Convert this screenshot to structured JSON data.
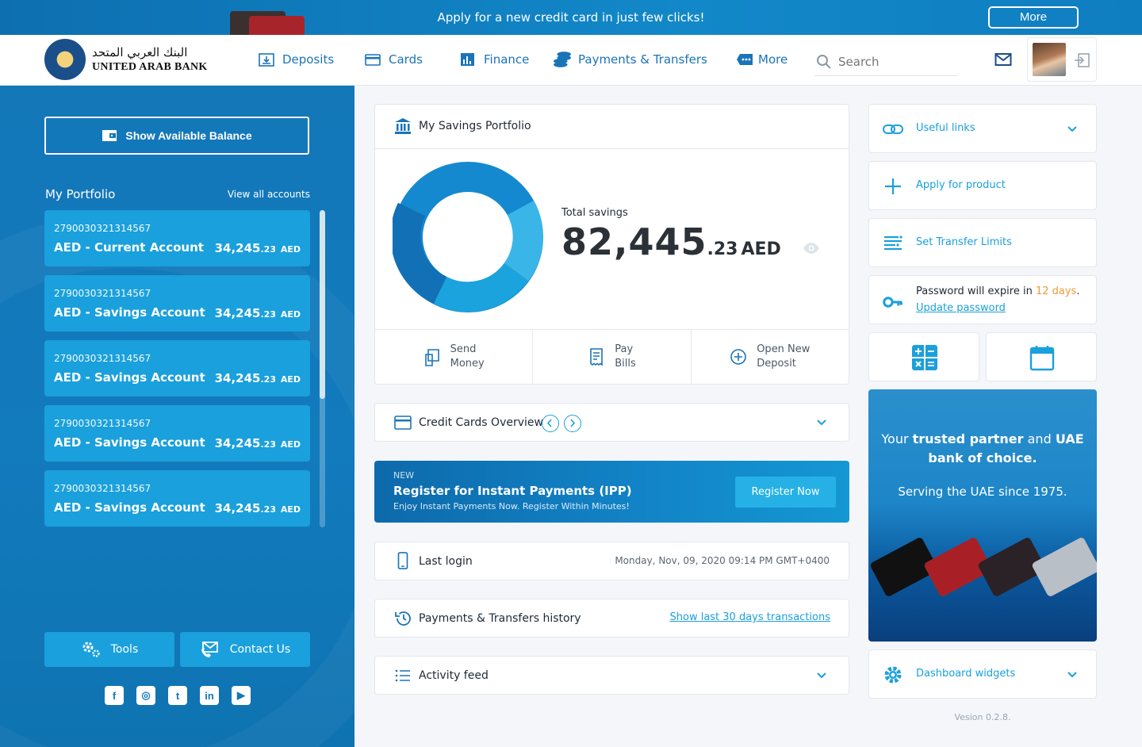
{
  "banner": {
    "text": "Apply for a new credit card in just few clicks!",
    "button": "More"
  },
  "logo": {
    "arabic": "البنك العربي المتحد",
    "english": "UNITED ARAB BANK"
  },
  "nav": [
    {
      "label": "Deposits",
      "icon": "deposits-icon"
    },
    {
      "label": "Cards",
      "icon": "cards-icon"
    },
    {
      "label": "Finance",
      "icon": "finance-icon"
    },
    {
      "label": "Payments & Transfers",
      "icon": "coins-icon"
    },
    {
      "label": "More",
      "icon": "more-icon"
    }
  ],
  "search": {
    "placeholder": "Search"
  },
  "sidebar": {
    "balance_button": "Show Available Balance",
    "portfolio_title": "My Portfolio",
    "view_all": "View all accounts",
    "accounts": [
      {
        "number": "2790030321314567",
        "name": "AED - Current Account",
        "int": "34,245",
        "dec": ".23",
        "cur": "AED"
      },
      {
        "number": "2790030321314567",
        "name": "AED - Savings Account",
        "int": "34,245",
        "dec": ".23",
        "cur": "AED"
      },
      {
        "number": "2790030321314567",
        "name": "AED - Savings Account",
        "int": "34,245",
        "dec": ".23",
        "cur": "AED"
      },
      {
        "number": "2790030321314567",
        "name": "AED - Savings Account",
        "int": "34,245",
        "dec": ".23",
        "cur": "AED"
      },
      {
        "number": "2790030321314567",
        "name": "AED - Savings Account",
        "int": "34,245",
        "dec": ".23",
        "cur": "AED"
      }
    ],
    "tools": "Tools",
    "contact": "Contact Us",
    "socials": [
      {
        "name": "facebook-icon",
        "glyph": "f"
      },
      {
        "name": "instagram-icon",
        "glyph": "◎"
      },
      {
        "name": "twitter-icon",
        "glyph": "t"
      },
      {
        "name": "linkedin-icon",
        "glyph": "in"
      },
      {
        "name": "youtube-icon",
        "glyph": "▶"
      }
    ]
  },
  "savings": {
    "title": "My Savings Portfolio",
    "total_label": "Total savings",
    "total_int": "82,445",
    "total_dec": ".23",
    "total_cur": "AED",
    "actions": [
      {
        "line1": "Send",
        "line2": "Money"
      },
      {
        "line1": "Pay",
        "line2": "Bills"
      },
      {
        "line1": "Open New",
        "line2": "Deposit"
      }
    ]
  },
  "credit_cards": {
    "title": "Credit Cards Overview"
  },
  "promo": {
    "tag": "NEW",
    "title": "Register for Instant Payments (IPP)",
    "subtitle": "Enjoy Instant Payments Now. Register Within Minutes!",
    "button": "Register Now"
  },
  "last_login": {
    "label": "Last login",
    "date": "Monday, Nov, 09, 2020 09:14 PM GMT+0400"
  },
  "history": {
    "label": "Payments & Transfers history",
    "link": "Show last 30 days transactions"
  },
  "activity": {
    "label": "Activity feed"
  },
  "right": {
    "useful_links": "Useful links",
    "apply_product": "Apply for product",
    "transfer_limits": "Set Transfer Limits",
    "pw_prefix": "Password will expire in ",
    "pw_days": "12 days",
    "pw_suffix": ".",
    "pw_link": "Update password",
    "ad_line1a": "Your ",
    "ad_line1b": "trusted partner",
    "ad_line1c": " and ",
    "ad_line1d": "UAE bank of choice.",
    "ad_line2": "Serving the UAE since 1975.",
    "dashboard_widgets": "Dashboard widgets",
    "version": "Vesion 0.2.8."
  },
  "colors": {
    "primary": "#1377b8",
    "accent": "#1aa0dc",
    "warning": "#f0993a"
  }
}
